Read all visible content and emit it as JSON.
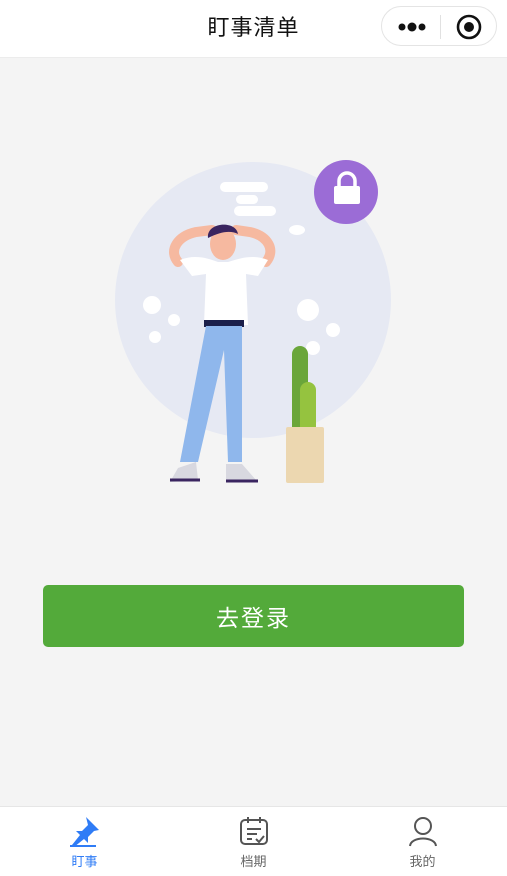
{
  "header": {
    "title": "盯事清单",
    "more_icon": "more-dots-icon",
    "close_icon": "target-close-icon"
  },
  "illustration": {
    "icon": "lock-icon",
    "accent_colors": {
      "circle": "#e6e9f3",
      "lock_badge": "#9b6cd6",
      "shirt": "#ffffff",
      "pants": "#8fb7ec",
      "plant": "#6aa63a",
      "pot": "#ecd7b0"
    }
  },
  "main": {
    "login_label": "去登录",
    "login_color": "#53aa3a"
  },
  "tabbar": {
    "active_color": "#2f7cf6",
    "items": [
      {
        "label": "盯事",
        "icon": "pin-icon",
        "active": true
      },
      {
        "label": "档期",
        "icon": "calendar-icon",
        "active": false
      },
      {
        "label": "我的",
        "icon": "user-icon",
        "active": false
      }
    ]
  }
}
